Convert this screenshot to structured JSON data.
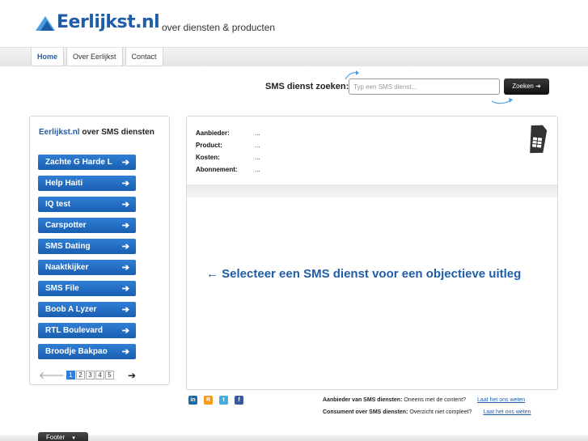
{
  "header": {
    "logo_text": "Eerlijkst.nl",
    "tagline": "over diensten & producten"
  },
  "nav": {
    "tabs": [
      {
        "label": "Home",
        "active": true
      },
      {
        "label": "Over Eerlijkst",
        "active": false
      },
      {
        "label": "Contact",
        "active": false
      }
    ]
  },
  "search": {
    "label": "SMS dienst zoeken:",
    "placeholder": "Typ een SMS dienst...",
    "button_label": "Zoeken",
    "button_arrow": "➔"
  },
  "sidebar": {
    "title_brand": "Eerlijkst.nl",
    "title_rest": " over SMS diensten",
    "items": [
      {
        "label": "Zachte G Harde L"
      },
      {
        "label": "Help Haiti"
      },
      {
        "label": "IQ test"
      },
      {
        "label": "Carspotter"
      },
      {
        "label": "SMS Dating"
      },
      {
        "label": "Naaktkijker"
      },
      {
        "label": "SMS File"
      },
      {
        "label": "Boob A Lyzer"
      },
      {
        "label": "RTL Boulevard"
      },
      {
        "label": "Broodje Bakpao"
      }
    ],
    "item_arrow": "➔",
    "pager": {
      "prev": "🡐",
      "next": "➔",
      "pages": [
        "1",
        "2",
        "3",
        "4",
        "5"
      ],
      "current": "1"
    }
  },
  "detail": {
    "rows": [
      {
        "key": "Aanbieder:",
        "value": "..."
      },
      {
        "key": "Product:",
        "value": "..."
      },
      {
        "key": "Kosten:",
        "value": "..."
      },
      {
        "key": "Abonnement:",
        "value": "..."
      }
    ],
    "message": "← Selecteer een SMS dienst voor een objectieve uitleg"
  },
  "social": {
    "icons": [
      {
        "name": "linkedin-icon",
        "glyph": "in",
        "color": "#1b6aa8"
      },
      {
        "name": "rss-icon",
        "glyph": "R",
        "color": "#f39a1f"
      },
      {
        "name": "twitter-icon",
        "glyph": "t",
        "color": "#44aee0"
      },
      {
        "name": "facebook-icon",
        "glyph": "f",
        "color": "#3b5998"
      }
    ]
  },
  "footer_links": {
    "line1_bold": "Aanbieder van SMS diensten:",
    "line1_text": " Oneens met de content?",
    "line1_link": "Laat het ons weten",
    "line2_bold": "Consument over SMS diensten:",
    "line2_text": " Overzicht niet compleet?",
    "line2_link": "Laat het ons weten"
  },
  "footer": {
    "tab_label": "Footer",
    "tab_icon": "▼"
  },
  "colors": {
    "brand_blue": "#1f5da8",
    "button_blue": "#2f7fd6",
    "dark_button": "#222222"
  }
}
